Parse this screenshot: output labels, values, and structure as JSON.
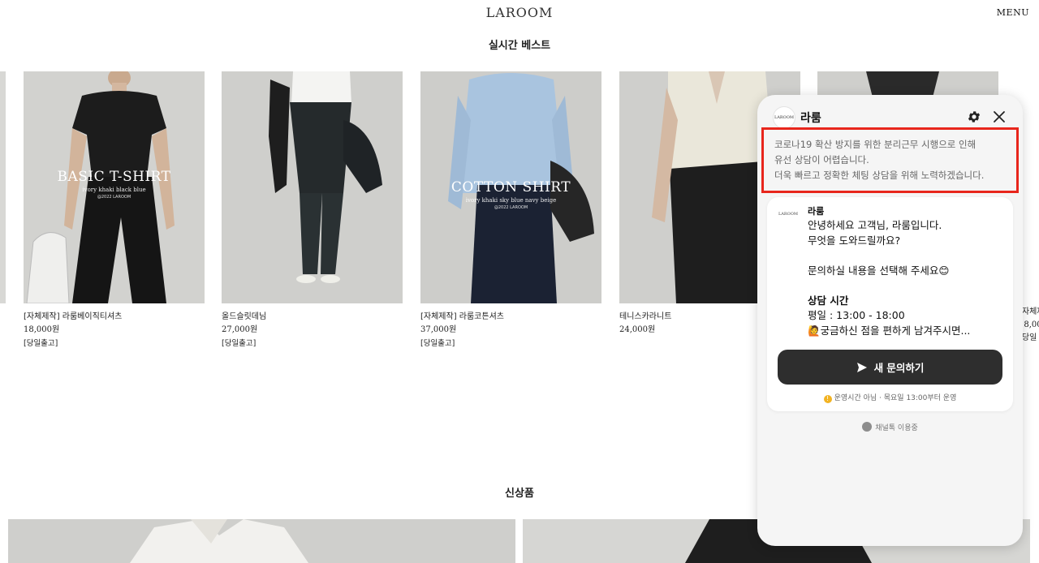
{
  "header": {
    "logo": "LAROOM",
    "menu": "MENU"
  },
  "best": {
    "title": "실시간 베스트",
    "products": [
      {
        "name": "[자체제작] 라룸베이직티셔츠",
        "price": "18,000원",
        "tag": "[당일출고]",
        "overlay": {
          "big": "BASIC T-SHIRT",
          "small": "ivory khaki black blue",
          "tiny": "@2022 LAROOM"
        }
      },
      {
        "name": "올드슬릿데님",
        "price": "27,000원",
        "tag": "[당일출고]"
      },
      {
        "name": "[자체제작] 라룸코튼셔츠",
        "price": "37,000원",
        "tag": "[당일출고]",
        "overlay": {
          "big": "COTTON SHIRT",
          "small": "ivory khaki sky blue navy beige",
          "tiny": "@2022 LAROOM"
        }
      },
      {
        "name": "테니스카라니트",
        "price": "24,000원",
        "tag": ""
      }
    ],
    "peek": {
      "name": "[자체제",
      "price": "18,00",
      "tag": "[당일"
    }
  },
  "new_section": {
    "title": "신상품"
  },
  "chat": {
    "brand": "라룸",
    "avatar_text": "LAROOM",
    "notice_lines": [
      "코로나19 확산 방지를 위한 분리근무 시행으로 인해",
      "유선 상담이 어렵습니다.",
      "더욱 빠르고 정확한 체팅 상담을 위해 노력하겠습니다."
    ],
    "sender": "라룸",
    "message": {
      "line1": "안녕하세요 고객님, 라룸입니다.",
      "line2": "무엇을 도와드릴까요?",
      "line3": "문의하실 내용을 선택해 주세요😊",
      "hours_title": "상담 시간",
      "hours_value": "평일 : 13:00 - 18:00",
      "line4": "🙋궁금하신 점을 편하게 남겨주시면..."
    },
    "cta": "새 문의하기",
    "hours_notice": "운영시간 아님 · 목요일 13:00부터 운영",
    "footer": "채널톡 이용중",
    "colors": {
      "highlight": "#e8261c",
      "cta_bg": "#2e2e2e",
      "status_dot": "#f2b322"
    }
  }
}
